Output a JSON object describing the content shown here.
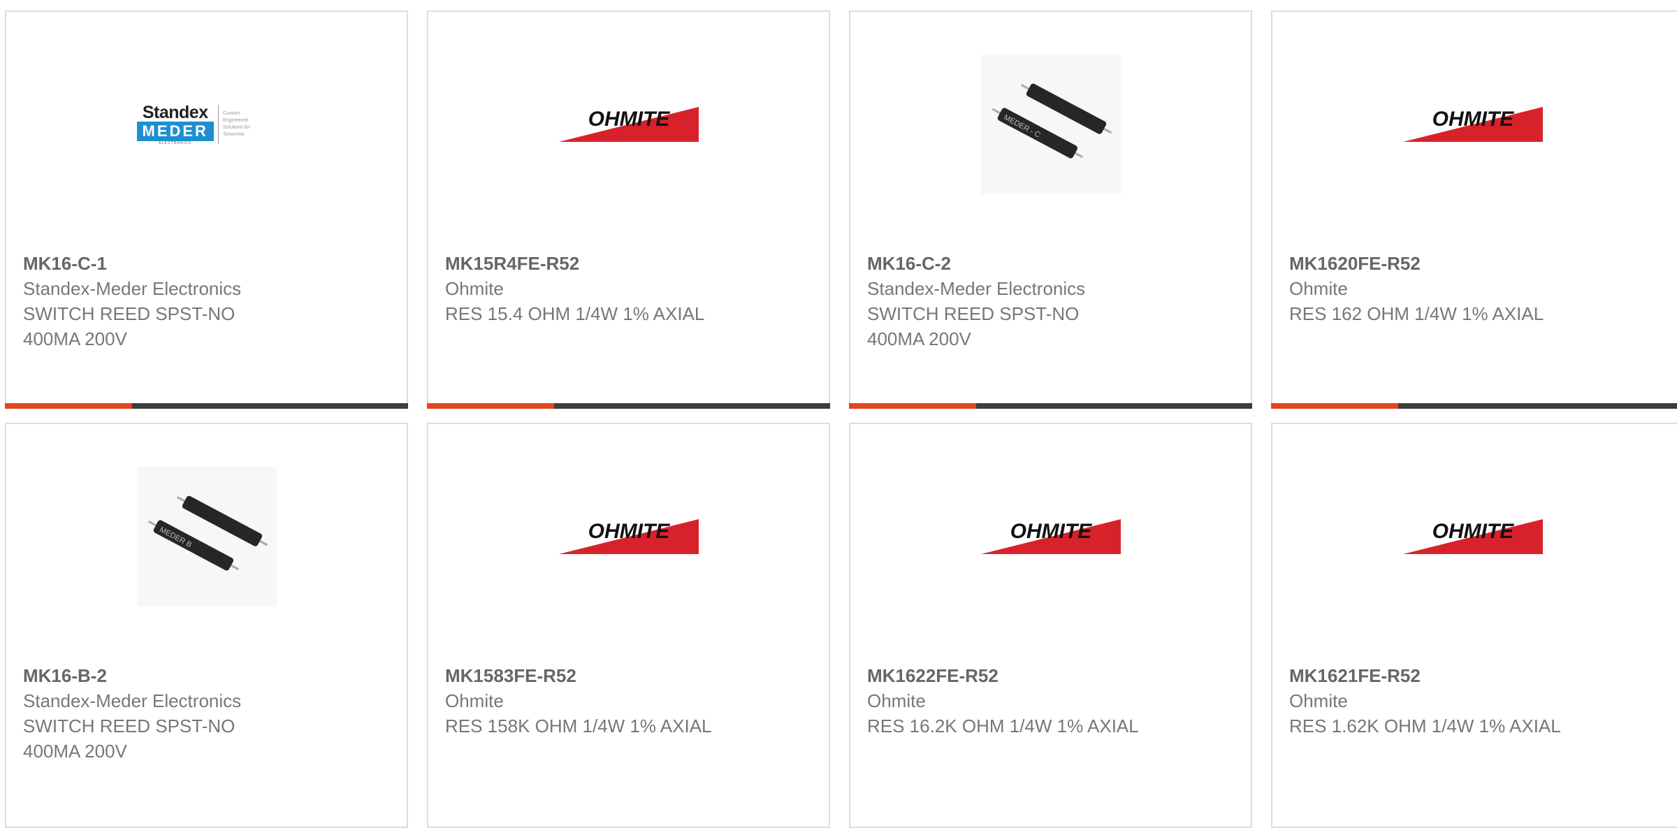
{
  "colors": {
    "accent": "#e8431e",
    "bar": "#3d3d3d",
    "card_border": "#dddddd",
    "title_text": "#666666",
    "body_text": "#777777",
    "ohmite_red": "#d8222b",
    "meder_blue": "#1d8fd1"
  },
  "logos": {
    "ohmite": "OHMITE",
    "standex": "Standex",
    "meder": "MEDER",
    "meder_sub": "ELECTRONICS",
    "standex_tagline": "Custom Engineered Solutions for Tomorrow"
  },
  "products": [
    {
      "part_number": "MK16-C-1",
      "manufacturer": "Standex-Meder Electronics",
      "description": "SWITCH REED SPST-NO\n400MA 200V",
      "image": "standex-meder-logo"
    },
    {
      "part_number": "MK15R4FE-R52",
      "manufacturer": "Ohmite",
      "description": "RES 15.4 OHM 1/4W 1% AXIAL",
      "image": "ohmite-logo"
    },
    {
      "part_number": "MK16-C-2",
      "manufacturer": "Standex-Meder Electronics",
      "description": "SWITCH REED SPST-NO\n400MA 200V",
      "image": "reed-switch-photo",
      "image_text": "MEDER - C"
    },
    {
      "part_number": "MK1620FE-R52",
      "manufacturer": "Ohmite",
      "description": "RES 162 OHM 1/4W 1% AXIAL",
      "image": "ohmite-logo"
    },
    {
      "part_number": "MK16-B-2",
      "manufacturer": "Standex-Meder Electronics",
      "description": "SWITCH REED SPST-NO\n400MA 200V",
      "image": "reed-switch-photo",
      "image_text": "MEDER B"
    },
    {
      "part_number": "MK1583FE-R52",
      "manufacturer": "Ohmite",
      "description": "RES 158K OHM 1/4W 1% AXIAL",
      "image": "ohmite-logo"
    },
    {
      "part_number": "MK1622FE-R52",
      "manufacturer": "Ohmite",
      "description": "RES 16.2K OHM 1/4W 1% AXIAL",
      "image": "ohmite-logo"
    },
    {
      "part_number": "MK1621FE-R52",
      "manufacturer": "Ohmite",
      "description": "RES 1.62K OHM 1/4W 1% AXIAL",
      "image": "ohmite-logo"
    }
  ]
}
